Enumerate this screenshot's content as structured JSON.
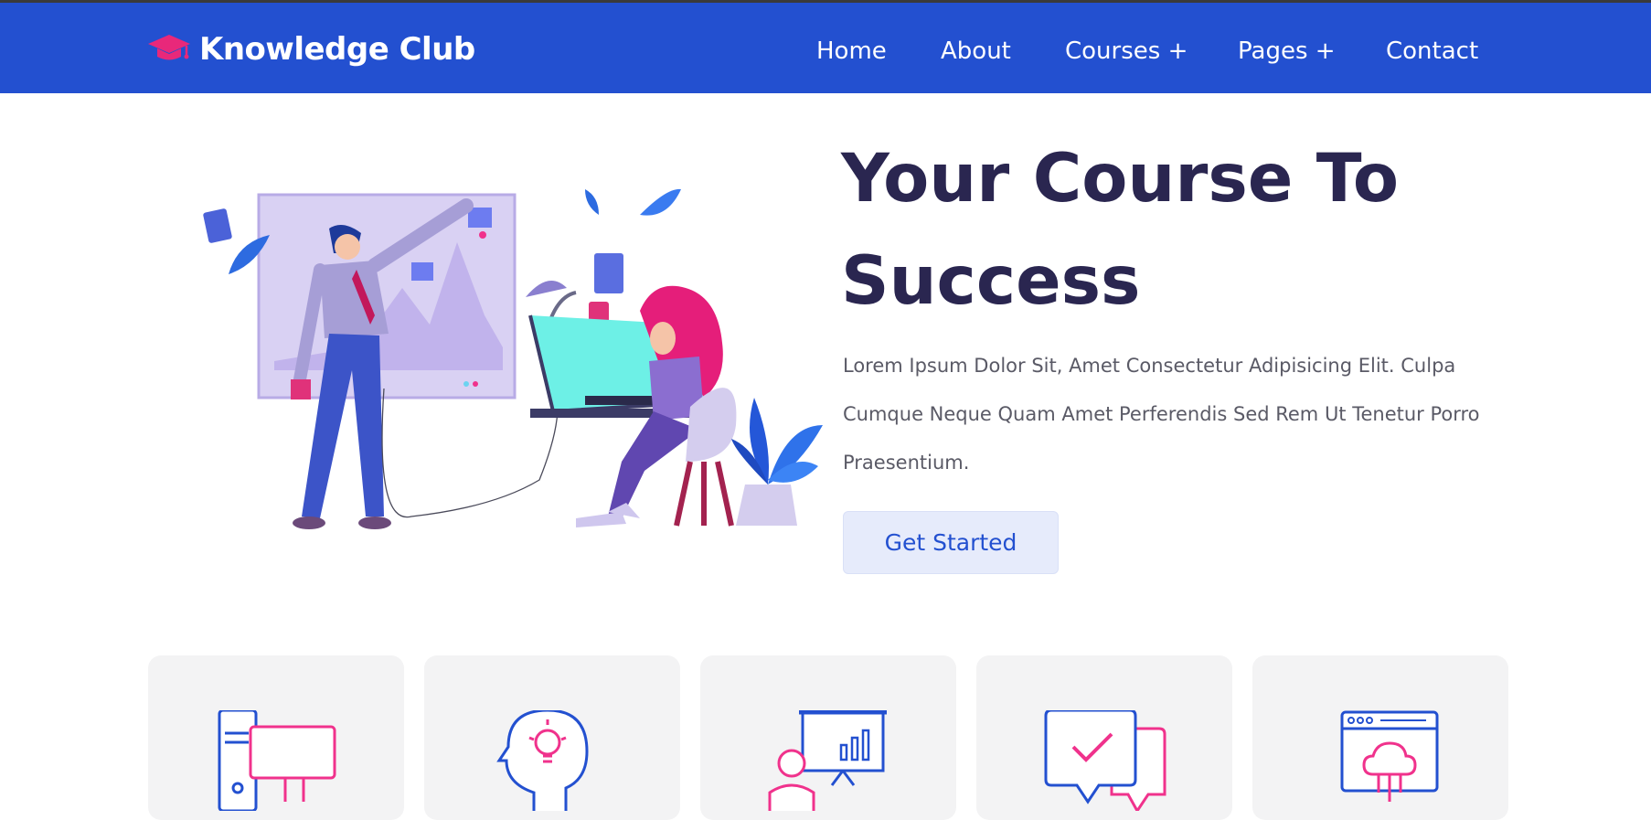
{
  "brand": {
    "name": "Knowledge Club",
    "icon": "graduation-cap-icon",
    "icon_color": "#e8287a"
  },
  "nav": {
    "items": [
      {
        "label": "Home"
      },
      {
        "label": "About"
      },
      {
        "label": "Courses +"
      },
      {
        "label": "Pages +"
      },
      {
        "label": "Contact"
      }
    ],
    "background": "#2350d0"
  },
  "hero": {
    "title_line1": "Your Course To",
    "title_line2": "Success",
    "text": "Lorem Ipsum Dolor Sit, Amet Consectetur Adipisicing Elit. Culpa Cumque Neque Quam Amet Perferendis Sed Rem Ut Tenetur Porro Praesentium.",
    "cta_label": "Get Started",
    "illustration": "team-learning-illustration"
  },
  "features": {
    "cards": [
      {
        "icon": "computer-icon"
      },
      {
        "icon": "idea-head-icon"
      },
      {
        "icon": "presentation-icon"
      },
      {
        "icon": "chat-check-icon"
      },
      {
        "icon": "cloud-network-icon"
      }
    ]
  },
  "colors": {
    "accent": "#2350d0",
    "pink": "#f0328c",
    "title": "#2a2650"
  }
}
